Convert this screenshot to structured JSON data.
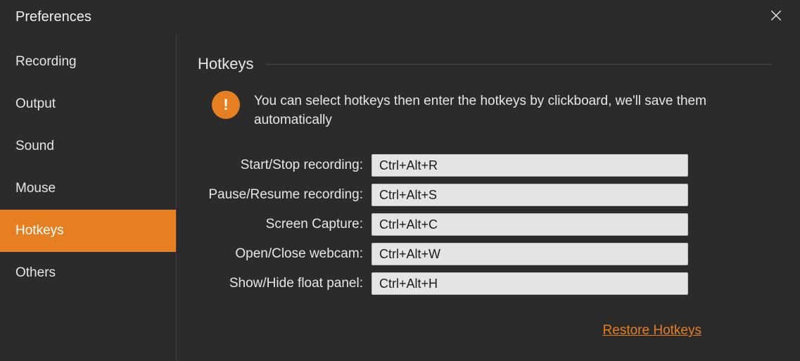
{
  "window": {
    "title": "Preferences"
  },
  "sidebar": {
    "items": [
      {
        "label": "Recording",
        "active": false
      },
      {
        "label": "Output",
        "active": false
      },
      {
        "label": "Sound",
        "active": false
      },
      {
        "label": "Mouse",
        "active": false
      },
      {
        "label": "Hotkeys",
        "active": true
      },
      {
        "label": "Others",
        "active": false
      }
    ]
  },
  "content": {
    "section_title": "Hotkeys",
    "info_glyph": "!",
    "info_text": "You can select hotkeys then enter the hotkeys by clickboard, we'll save them automatically",
    "rows": [
      {
        "label": "Start/Stop recording:",
        "value": "Ctrl+Alt+R"
      },
      {
        "label": "Pause/Resume recording:",
        "value": "Ctrl+Alt+S"
      },
      {
        "label": "Screen Capture:",
        "value": "Ctrl+Alt+C"
      },
      {
        "label": "Open/Close webcam:",
        "value": "Ctrl+Alt+W"
      },
      {
        "label": "Show/Hide float panel:",
        "value": "Ctrl+Alt+H"
      }
    ],
    "restore_label": "Restore Hotkeys"
  }
}
